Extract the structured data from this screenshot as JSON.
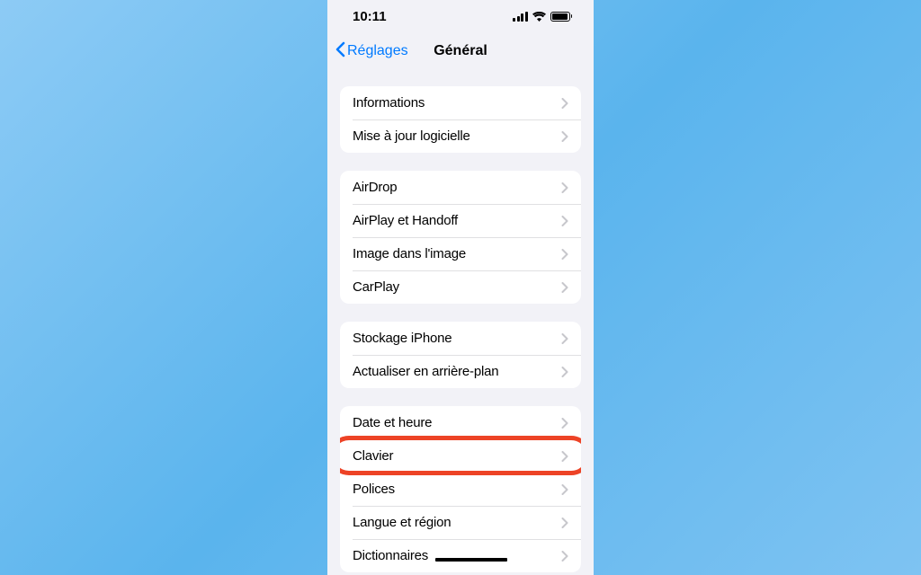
{
  "status": {
    "time": "10:11"
  },
  "nav": {
    "back_label": "Réglages",
    "title": "Général"
  },
  "sections": [
    {
      "items": [
        {
          "label": "Informations"
        },
        {
          "label": "Mise à jour logicielle"
        }
      ]
    },
    {
      "items": [
        {
          "label": "AirDrop"
        },
        {
          "label": "AirPlay et Handoff"
        },
        {
          "label": "Image dans l'image"
        },
        {
          "label": "CarPlay"
        }
      ]
    },
    {
      "items": [
        {
          "label": "Stockage iPhone"
        },
        {
          "label": "Actualiser en arrière-plan"
        }
      ]
    },
    {
      "items": [
        {
          "label": "Date et heure"
        },
        {
          "label": "Clavier",
          "highlighted": true
        },
        {
          "label": "Polices"
        },
        {
          "label": "Langue et région"
        },
        {
          "label": "Dictionnaires",
          "redacted": true
        }
      ]
    }
  ]
}
